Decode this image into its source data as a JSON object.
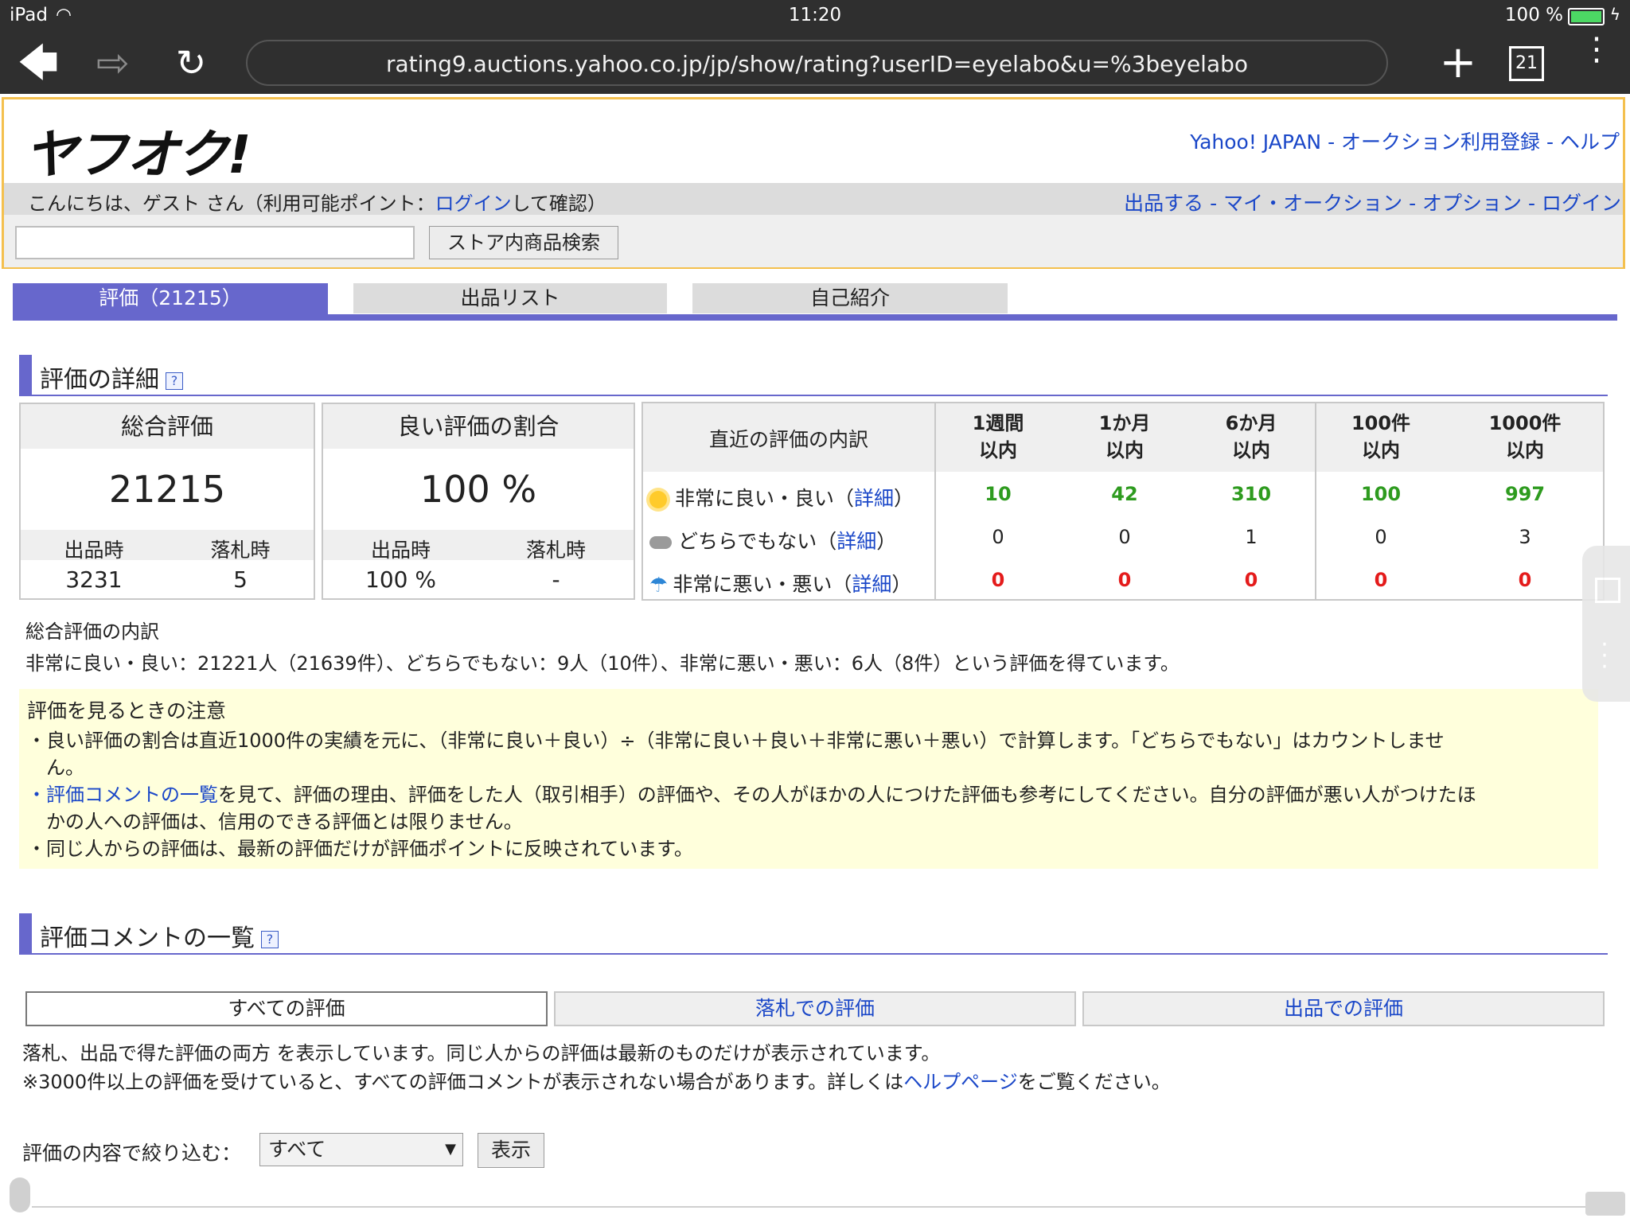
{
  "status": {
    "carrier": "iPad",
    "time": "11:20",
    "battery": "100 %"
  },
  "browser": {
    "url": "rating9.auctions.yahoo.co.jp/jp/show/rating?userID=eyelabo&u=%3beyelabo",
    "tab_count": "21"
  },
  "header": {
    "logo": "ヤフオク!",
    "links": [
      "Yahoo! JAPAN",
      "オークション利用登録",
      "ヘルプ"
    ],
    "greeting_prefix": "こんにちは、ゲスト さん（利用可能ポイント：",
    "greeting_link": "ログイン",
    "greeting_suffix": "して確認）",
    "user_links": [
      "出品する",
      "マイ・オークション",
      "オプション",
      "ログイン"
    ],
    "search_button": "ストア内商品検索"
  },
  "tabs": [
    "評価（21215）",
    "出品リスト",
    "自己紹介"
  ],
  "section1": {
    "title": "評価の詳細"
  },
  "total_box": {
    "title": "総合評価",
    "value": "21215",
    "sub_left": "出品時",
    "sub_right": "落札時",
    "val_left": "3231",
    "val_right": "5"
  },
  "ratio_box": {
    "title": "良い評価の割合",
    "value": "100 %",
    "sub_left": "出品時",
    "sub_right": "落札時",
    "val_left": "100 %",
    "val_right": "-"
  },
  "recent": {
    "header_label": "直近の評価の内訳",
    "columns": [
      {
        "a": "1週間",
        "b": "以内"
      },
      {
        "a": "1か月",
        "b": "以内"
      },
      {
        "a": "6か月",
        "b": "以内"
      },
      {
        "a": "100件",
        "b": "以内"
      },
      {
        "a": "1000件",
        "b": "以内"
      }
    ],
    "detail_link": "詳細",
    "rows": [
      {
        "label": "非常に良い・良い",
        "values": [
          "10",
          "42",
          "310",
          "100",
          "997"
        ]
      },
      {
        "label": "どちらでもない",
        "values": [
          "0",
          "0",
          "1",
          "0",
          "3"
        ]
      },
      {
        "label": "非常に悪い・悪い",
        "values": [
          "0",
          "0",
          "0",
          "0",
          "0"
        ]
      }
    ]
  },
  "breakdown": {
    "heading": "総合評価の内訳",
    "text": "非常に良い・良い：21221人（21639件）、どちらでもない：9人（10件）、非常に悪い・悪い：6人（8件）という評価を得ています。"
  },
  "notes": {
    "heading": "評価を見るときの注意",
    "line1": "・良い評価の割合は直近1000件の実績を元に、（非常に良い＋良い）÷（非常に良い＋良い＋非常に悪い＋悪い）で計算します。「どちらでもない」はカウントしませ",
    "line1b": "ん。",
    "line2_link": "評価コメントの一覧",
    "line2": "を見て、評価の理由、評価をした人（取引相手）の評価や、その人がほかの人につけた評価も参考にしてください。自分の評価が悪い人がつけたほ",
    "line2b": "かの人への評価は、信用のできる評価とは限りません。",
    "line3": "・同じ人からの評価は、最新の評価だけが評価ポイントに反映されています。"
  },
  "section2": {
    "title": "評価コメントの一覧"
  },
  "filter_tabs": [
    "すべての評価",
    "落札での評価",
    "出品での評価"
  ],
  "info": {
    "line1": "落札、出品で得た評価の両方 を表示しています。同じ人からの評価は最新のものだけが表示されています。",
    "line2_prefix": "※3000件以上の評価を受けていると、すべての評価コメントが表示されない場合があります。詳しくは",
    "line2_link": "ヘルプページ",
    "line2_suffix": "をご覧ください。"
  },
  "filter": {
    "label": "評価の内容で絞り込む：",
    "selected": "すべて",
    "button": "表示"
  }
}
